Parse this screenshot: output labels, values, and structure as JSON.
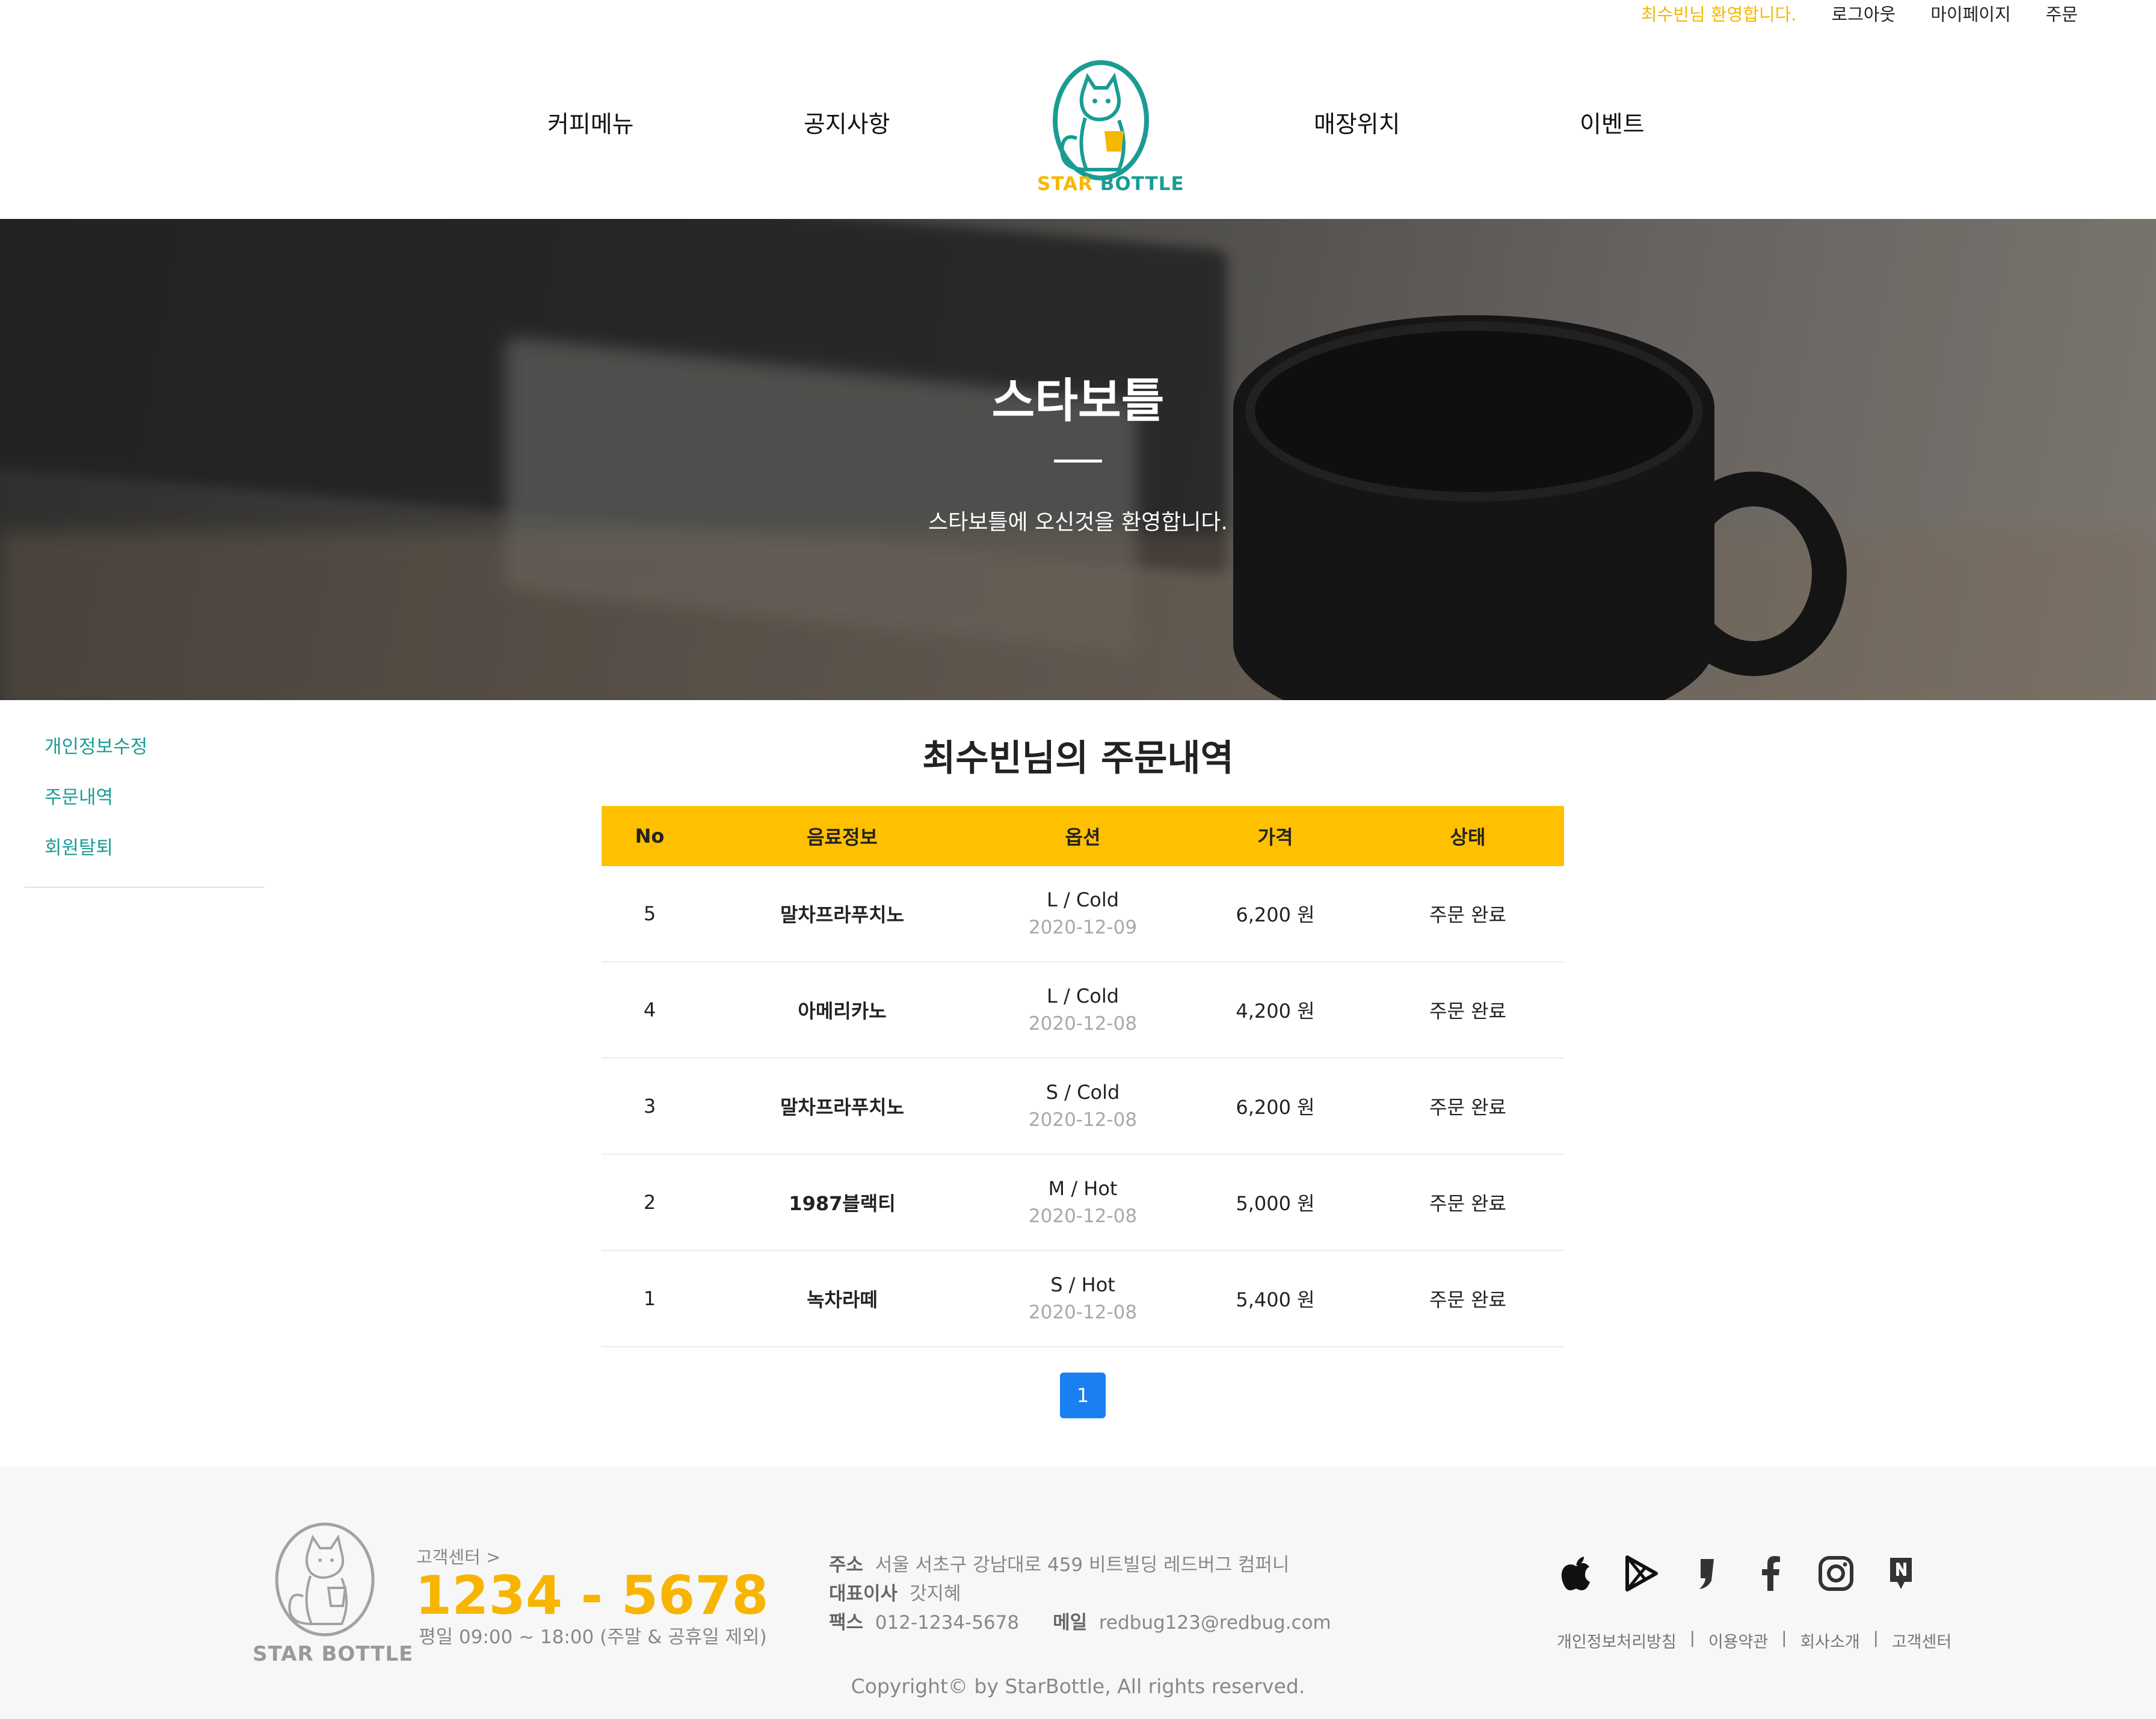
{
  "header": {
    "welcome": "최수빈님 환영합니다.",
    "logout": "로그아웃",
    "mypage": "마이페이지",
    "order": "주문",
    "nav": [
      "커피메뉴",
      "공지사항",
      "매장위치",
      "이벤트"
    ],
    "logo_star": "STAR",
    "logo_bottle": "BOTTLE",
    "accent_yellow": "#f5b800",
    "accent_teal": "#1a9c94"
  },
  "hero": {
    "title": "스타보틀",
    "subtitle": "스타보틀에 오신것을 환영합니다."
  },
  "sidebar": {
    "items": [
      "개인정보수정",
      "주문내역",
      "회원탈퇴"
    ]
  },
  "orders": {
    "title": "최수빈님의 주문내역",
    "headers": [
      "No",
      "음료정보",
      "옵션",
      "가격",
      "상태"
    ],
    "rows": [
      {
        "no": "5",
        "name": "말차프라푸치노",
        "option": "L / Cold",
        "date": "2020-12-09",
        "price": "6,200 원",
        "status": "주문 완료"
      },
      {
        "no": "4",
        "name": "아메리카노",
        "option": "L / Cold",
        "date": "2020-12-08",
        "price": "4,200 원",
        "status": "주문 완료"
      },
      {
        "no": "3",
        "name": "말차프라푸치노",
        "option": "S / Cold",
        "date": "2020-12-08",
        "price": "6,200 원",
        "status": "주문 완료"
      },
      {
        "no": "2",
        "name": "1987블랙티",
        "option": "M / Hot",
        "date": "2020-12-08",
        "price": "5,000 원",
        "status": "주문 완료"
      },
      {
        "no": "1",
        "name": "녹차라떼",
        "option": "S / Hot",
        "date": "2020-12-08",
        "price": "5,400 원",
        "status": "주문 완료"
      }
    ],
    "page": "1",
    "header_color": "#ffc000",
    "page_color": "#1a7ff0"
  },
  "footer": {
    "logo_text": "STAR BOTTLE",
    "cs_label": "고객센터 >",
    "cs_phone": "1234 - 5678",
    "cs_hours": "평일 09:00 ~ 18:00 (주말 & 공휴일 제외)",
    "address_label": "주소",
    "address": "서울 서초구 강남대로 459 비트빌딩 레드버그 컴퍼니",
    "ceo_label": "대표이사",
    "ceo": "갓지혜",
    "fax_label": "팩스",
    "fax": "012-1234-5678",
    "mail_label": "메일",
    "mail": "redbug123@redbug.com",
    "sns_icons": [
      "apple-icon",
      "google-play-icon",
      "kakao-story-icon",
      "facebook-icon",
      "instagram-icon",
      "naver-blog-icon"
    ],
    "links": [
      "개인정보처리방침",
      "이용약관",
      "회사소개",
      "고객센터"
    ],
    "copyright": "Copyright© by StarBottle, All rights reserved."
  }
}
